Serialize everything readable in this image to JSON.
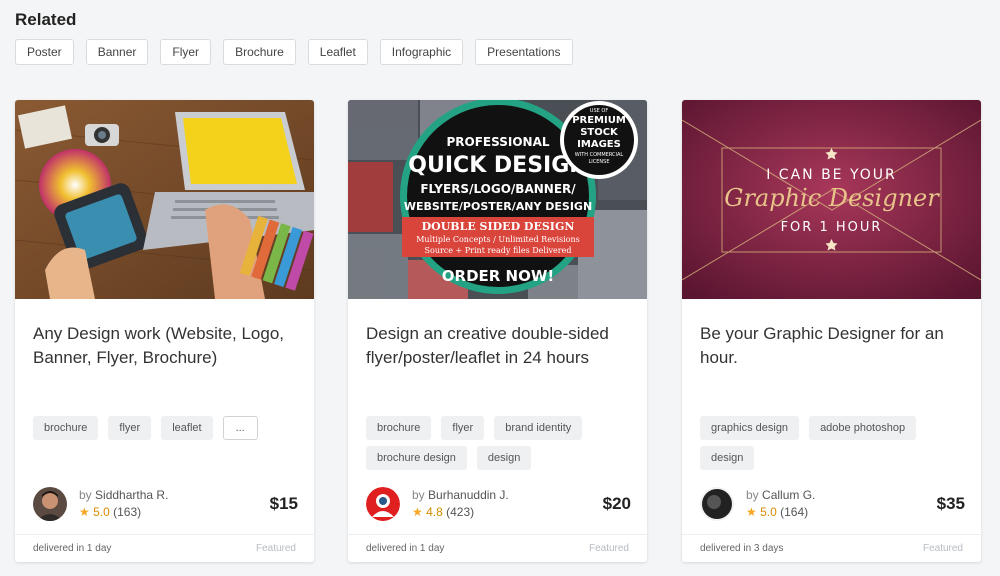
{
  "page_title": "Related",
  "related_tags": [
    "Poster",
    "Banner",
    "Flyer",
    "Brochure",
    "Leaflet",
    "Infographic",
    "Presentations"
  ],
  "cards": [
    {
      "title": "Any Design work (Website, Logo, Banner, Flyer, Brochure)",
      "thumb_image": "designer-desk-laptop-photo",
      "tags": [
        "brochure",
        "flyer",
        "leaflet"
      ],
      "more_label": "...",
      "by": "by",
      "seller": "Siddhartha R.",
      "rating": "5.0",
      "reviews": "(163)",
      "price": "$15",
      "delivered": "delivered in 1 day",
      "featured": "Featured"
    },
    {
      "title": "Design an creative double-sided flyer/poster/leaflet in 24 hours",
      "thumb_image": "quick-design-promo-graphic",
      "thumb_text": {
        "professional": "PROFESSIONAL",
        "quick": "QUICK DESIGN",
        "line1": "FLYERS/LOGO/BANNER/",
        "line2": "WEBSITE/POSTER/ANY DESIGN",
        "double": "DOUBLE SIDED DESIGN",
        "multi": "Multiple Concepts / Unlimited Revisions",
        "source": "Source + Print ready files Delivered",
        "order": "ORDER NOW!",
        "use_of": "USE OF",
        "premium": "PREMIUM",
        "stock": "STOCK",
        "images": "IMAGES",
        "with": "WITH COMMERCIAL",
        "license": "LICENSE"
      },
      "tags": [
        "brochure",
        "flyer",
        "brand identity",
        "brochure design",
        "design"
      ],
      "by": "by",
      "seller": "Burhanuddin J.",
      "rating": "4.8",
      "reviews": "(423)",
      "price": "$20",
      "delivered": "delivered in 1 day",
      "featured": "Featured"
    },
    {
      "title": "Be your Graphic Designer for an hour.",
      "thumb_image": "graphic-designer-banner",
      "thumb_text": {
        "top": "I CAN BE YOUR",
        "mid": "Graphic Designer",
        "bottom": "FOR 1 HOUR"
      },
      "tags": [
        "graphics design",
        "adobe photoshop",
        "design"
      ],
      "by": "by",
      "seller": "Callum G.",
      "rating": "5.0",
      "reviews": "(164)",
      "price": "$35",
      "delivered": "delivered in 3 days",
      "featured": "Featured"
    }
  ]
}
